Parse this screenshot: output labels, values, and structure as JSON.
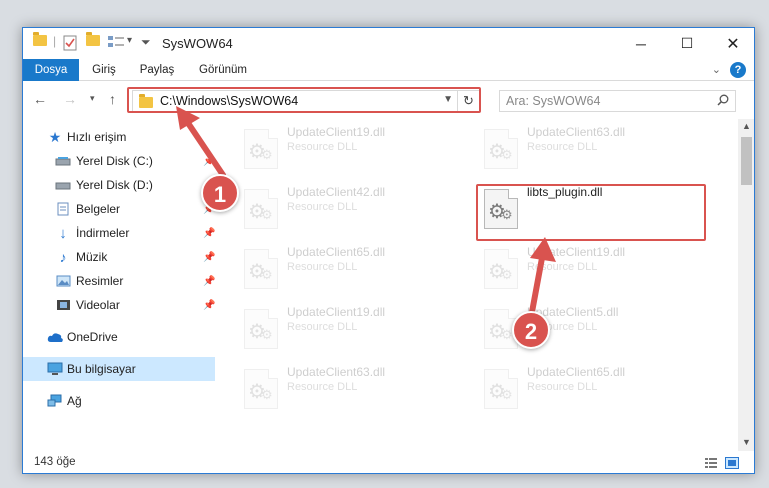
{
  "window": {
    "title": "SysWOW64"
  },
  "ribbon": {
    "tabs": [
      {
        "label": "Dosya",
        "active": true
      },
      {
        "label": "Giriş"
      },
      {
        "label": "Paylaş"
      },
      {
        "label": "Görünüm"
      }
    ],
    "help_label": "?"
  },
  "nav": {
    "address": "C:\\Windows\\SysWOW64",
    "search_placeholder": "Ara: SysWOW64"
  },
  "sidebar": {
    "items": [
      {
        "label": "Hızlı erişim",
        "icon": "star-icon",
        "pinned": false
      },
      {
        "label": "Yerel Disk (C:)",
        "icon": "drive-icon",
        "pinned": true
      },
      {
        "label": "Yerel Disk (D:)",
        "icon": "drive-icon",
        "pinned": true
      },
      {
        "label": "Belgeler",
        "icon": "documents-icon",
        "pinned": true
      },
      {
        "label": "İndirmeler",
        "icon": "download-icon",
        "pinned": true
      },
      {
        "label": "Müzik",
        "icon": "music-icon",
        "pinned": true
      },
      {
        "label": "Resimler",
        "icon": "pictures-icon",
        "pinned": true
      },
      {
        "label": "Videolar",
        "icon": "video-icon",
        "pinned": true
      },
      {
        "label": "OneDrive",
        "icon": "cloud-icon"
      },
      {
        "label": "Bu bilgisayar",
        "icon": "computer-icon",
        "selected": true
      },
      {
        "label": "Ağ",
        "icon": "network-icon"
      }
    ]
  },
  "files": [
    {
      "name": "UpdateClient19.dll",
      "type": "Resource DLL",
      "faded": true
    },
    {
      "name": "UpdateClient63.dll",
      "type": "Resource DLL",
      "faded": true
    },
    {
      "name": "UpdateClient42.dll",
      "type": "Resource DLL",
      "faded": true
    },
    {
      "name": "libts_plugin.dll",
      "type": "",
      "faded": false
    },
    {
      "name": "UpdateClient65.dll",
      "type": "Resource DLL",
      "faded": true
    },
    {
      "name": "UpdateClient19.dll",
      "type": "Resource DLL",
      "faded": true
    },
    {
      "name": "UpdateClient19.dll",
      "type": "Resource DLL",
      "faded": true
    },
    {
      "name": "UpdateClient5.dll",
      "type": "Resource DLL",
      "faded": true
    },
    {
      "name": "UpdateClient63.dll",
      "type": "Resource DLL",
      "faded": true
    },
    {
      "name": "UpdateClient65.dll",
      "type": "Resource DLL",
      "faded": true
    }
  ],
  "status": {
    "item_count": "143 öğe"
  },
  "callouts": [
    "1",
    "2"
  ],
  "colors": {
    "accent": "#1979ca",
    "highlight": "#d9534f",
    "selected_bg": "#cce8ff"
  }
}
